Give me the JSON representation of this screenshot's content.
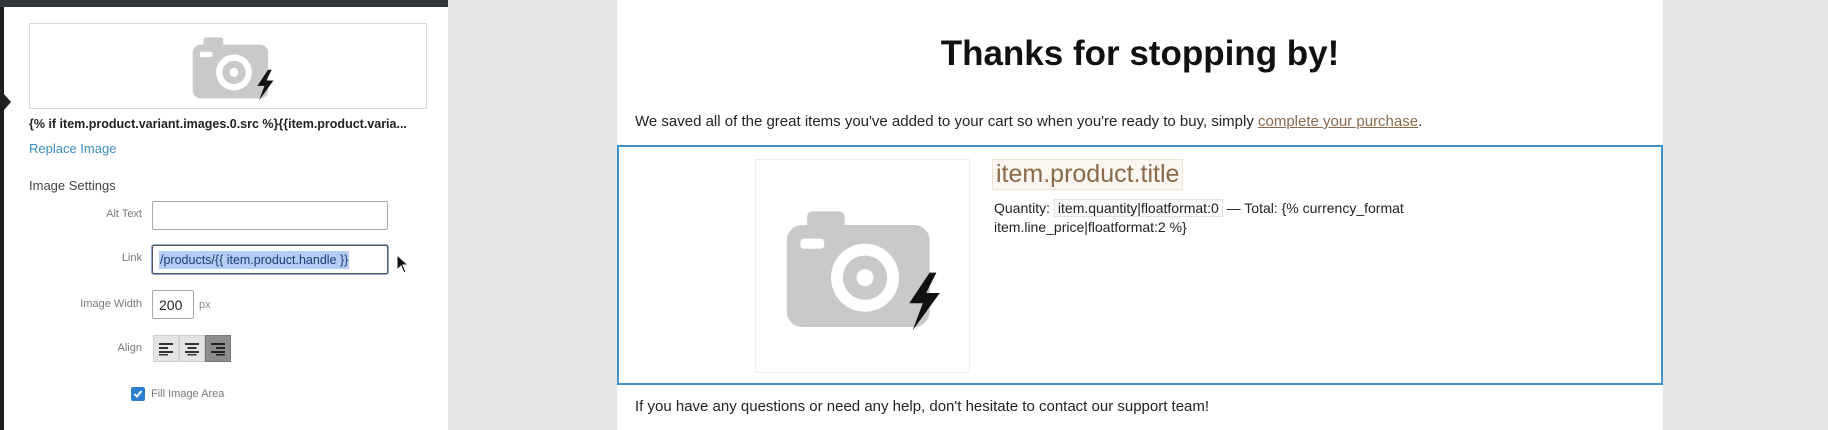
{
  "panel": {
    "liquid_src": "{% if item.product.variant.images.0.src %}{{item.product.varia...",
    "replace_link": "Replace Image",
    "section_title": "Image Settings",
    "alt_text_label": "Alt Text",
    "alt_text_value": "",
    "link_label": "Link",
    "link_value": "/products/{{ item.product.handle }}",
    "image_width_label": "Image Width",
    "image_width_value": "200",
    "image_width_unit": "px",
    "align_label": "Align",
    "align_options": [
      "left",
      "center",
      "right"
    ],
    "align_selected": "right",
    "fill_image_area_label": "Fill Image Area",
    "fill_image_area_checked": true
  },
  "email": {
    "title": "Thanks for stopping by!",
    "intro_text": "We saved all of the great items you've added to your cart so when you're ready to buy, simply ",
    "intro_link": "complete your purchase",
    "intro_end": ".",
    "product_title": "item.product.title",
    "quantity_label": "Quantity: ",
    "quantity_value": "item.quantity|floatformat:0",
    "total_text": " — Total: {% currency_format item.line_price|floatformat:2 %}",
    "footer_text": "If you have any questions or need any help, don't hesitate to contact our support team!"
  },
  "icons": {
    "placeholder": "camera-flash-icon",
    "cursor": "mouse-pointer-icon",
    "checkbox": "checkmark-icon"
  },
  "colors": {
    "link": "#3a8bbd",
    "selection_border": "#3f93c8",
    "accent_brown": "#8a6a4a",
    "checkbox": "#2f7fd1"
  }
}
